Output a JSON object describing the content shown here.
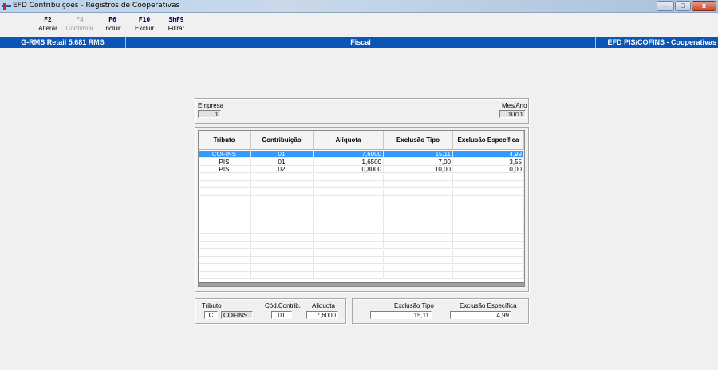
{
  "window": {
    "title": "EFD Contribuições - Registros de Cooperativas",
    "min_glyph": "–",
    "max_glyph": "□",
    "close_glyph": "x"
  },
  "toolbar": {
    "buttons": [
      {
        "key": "F2",
        "label": "Alterar",
        "enabled": true
      },
      {
        "key": "F4",
        "label": "Confirmar",
        "enabled": false
      },
      {
        "key": "F6",
        "label": "Incluir",
        "enabled": true
      },
      {
        "key": "F10",
        "label": "Excluir",
        "enabled": true
      },
      {
        "key": "ShF9",
        "label": "Filtrar",
        "enabled": true
      }
    ]
  },
  "band": {
    "left": "G-RMS Retail 5.681 RMS",
    "center": "Fiscal",
    "right": "EFD PIS/COFINS - Cooperativas"
  },
  "header_panel": {
    "empresa_label": "Empresa",
    "empresa_value": "1",
    "mes_ano_label": "Mes/Ano",
    "mes_ano_value": "10/11"
  },
  "grid": {
    "columns": [
      "Tributo",
      "Contribuição",
      "Alíquota",
      "Exclusão Tipo",
      "Exclusão Específica"
    ],
    "rows": [
      {
        "tributo": "COFINS",
        "contribuicao": "01",
        "aliquota": "7,6000",
        "exclusao_tipo": "15,11",
        "exclusao_especifica": "4,99",
        "selected": true
      },
      {
        "tributo": "PIS",
        "contribuicao": "01",
        "aliquota": "1,6500",
        "exclusao_tipo": "7,00",
        "exclusao_especifica": "3,55",
        "selected": false
      },
      {
        "tributo": "PIS",
        "contribuicao": "02",
        "aliquota": "0,8000",
        "exclusao_tipo": "10,00",
        "exclusao_especifica": "0,00",
        "selected": false
      }
    ]
  },
  "detail_left": {
    "tributo_label": "Tributo",
    "tributo_code": "C",
    "tributo_name": "COFINS",
    "cod_contrib_label": "Cód.Contrib.",
    "cod_contrib_value": "01",
    "aliquota_label": "Aliquota",
    "aliquota_value": "7,6000"
  },
  "detail_right": {
    "exclusao_tipo_label": "Exclusão Tipo",
    "exclusao_tipo_value": "15,11",
    "exclusao_especifica_label": "Exclusão Específica",
    "exclusao_especifica_value": "4,99"
  },
  "colors": {
    "band": "#0a55b5",
    "selection": "#3399ff"
  }
}
